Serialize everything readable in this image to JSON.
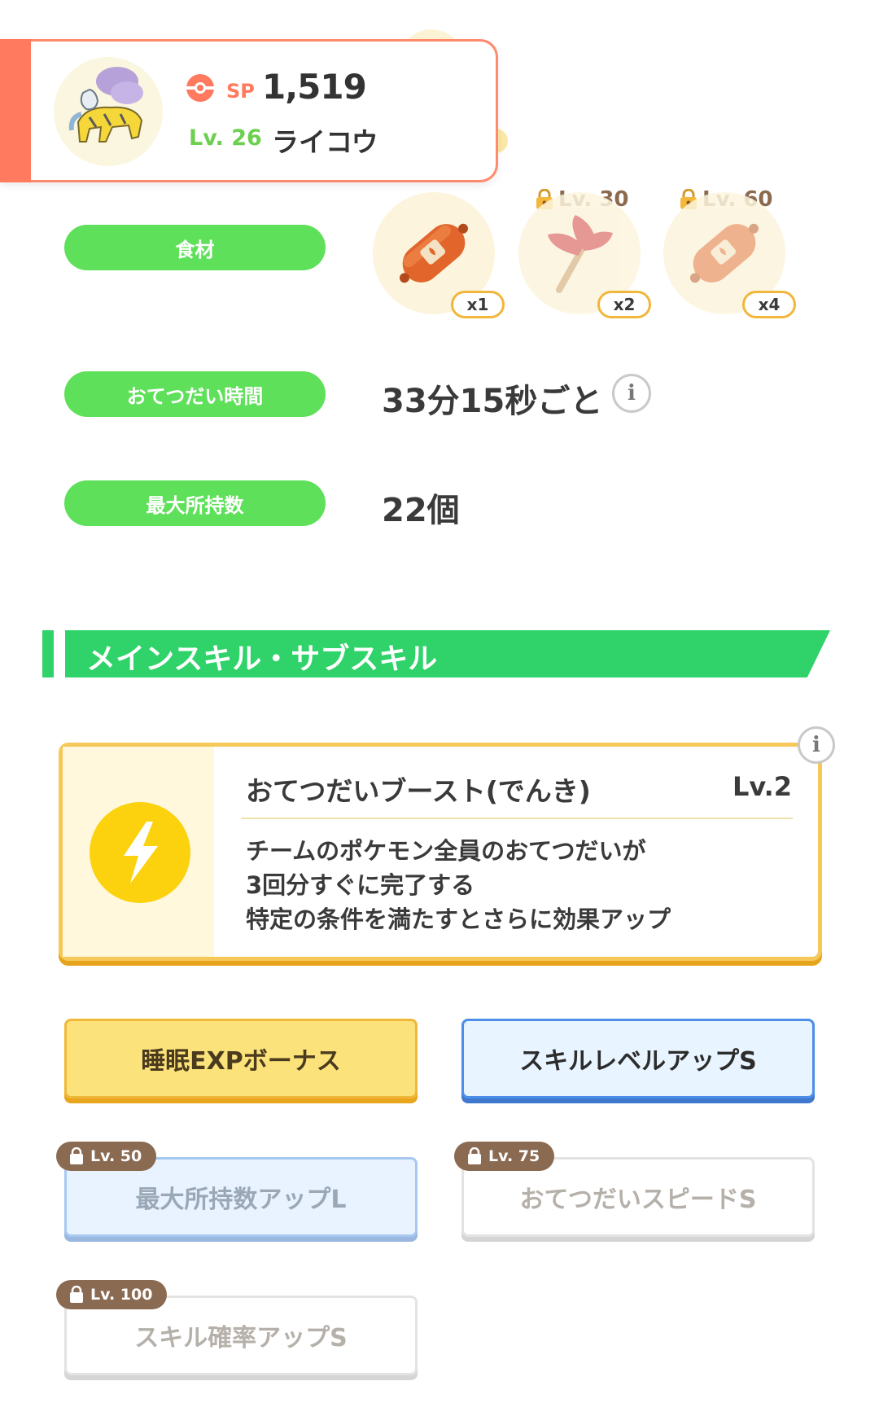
{
  "header": {
    "sp_label": "SP",
    "sp_value": "1,519",
    "level": "Lv. 26",
    "pokemon_name": "ライコウ",
    "accent_color": "#ff7a5e"
  },
  "ingredients": {
    "label": "食材",
    "items": [
      {
        "icon": "sausage-icon",
        "count": "x1",
        "lock_level": ""
      },
      {
        "icon": "leaf-icon",
        "count": "x2",
        "lock_level": "Lv. 30"
      },
      {
        "icon": "sausage-icon",
        "count": "x4",
        "lock_level": "Lv. 60"
      }
    ]
  },
  "help_time": {
    "label": "おてつだい時間",
    "value": "33分15秒ごと"
  },
  "max_carry": {
    "label": "最大所持数",
    "value": "22個"
  },
  "section": {
    "title": "メインスキル・サブスキル"
  },
  "main_skill": {
    "name": "おてつだいブースト(でんき)",
    "level": "Lv.2",
    "description": [
      "チームのポケモン全員のおてつだいが",
      "3回分すぐに完了する",
      "特定の条件を満たすとさらに効果アップ"
    ]
  },
  "sub_skills": [
    {
      "label": "睡眠EXPボーナス",
      "lock_level": ""
    },
    {
      "label": "スキルレベルアップS",
      "lock_level": ""
    },
    {
      "label": "最大所持数アップL",
      "lock_level": "Lv. 50"
    },
    {
      "label": "おてつだいスピードS",
      "lock_level": "Lv. 75"
    },
    {
      "label": "スキル確率アップS",
      "lock_level": "Lv. 100"
    }
  ]
}
